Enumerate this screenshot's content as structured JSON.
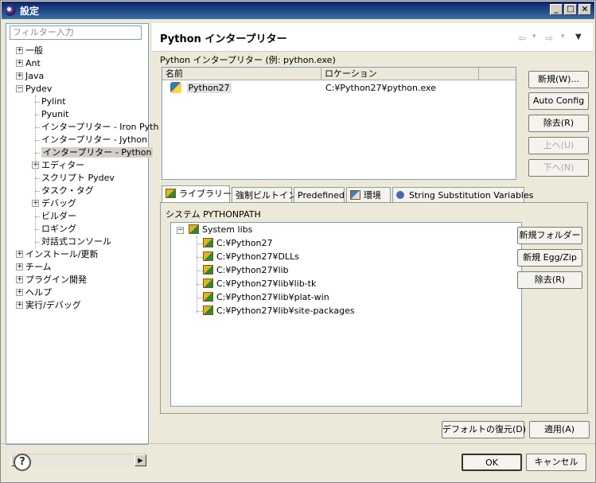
{
  "window": {
    "title": "設定",
    "min": "_",
    "max": "□",
    "close": "×"
  },
  "filter": {
    "placeholder": "フィルター入力"
  },
  "tree": {
    "items": [
      {
        "label": "一般",
        "level": 0,
        "expander": "+"
      },
      {
        "label": "Ant",
        "level": 0,
        "expander": "+"
      },
      {
        "label": "Java",
        "level": 0,
        "expander": "+"
      },
      {
        "label": "Pydev",
        "level": 0,
        "expander": "−"
      },
      {
        "label": "Pylint",
        "level": 1,
        "expander": ""
      },
      {
        "label": "Pyunit",
        "level": 1,
        "expander": ""
      },
      {
        "label": "インタープリター - Iron Pyth",
        "level": 1,
        "expander": ""
      },
      {
        "label": "インタープリター - Jython",
        "level": 1,
        "expander": ""
      },
      {
        "label": "インタープリター - Python",
        "level": 1,
        "expander": "",
        "selected": true
      },
      {
        "label": "エディター",
        "level": 1,
        "expander": "+"
      },
      {
        "label": "スクリプト Pydev",
        "level": 1,
        "expander": ""
      },
      {
        "label": "タスク・タグ",
        "level": 1,
        "expander": ""
      },
      {
        "label": "デバッグ",
        "level": 1,
        "expander": "+"
      },
      {
        "label": "ビルダー",
        "level": 1,
        "expander": ""
      },
      {
        "label": "ロギング",
        "level": 1,
        "expander": ""
      },
      {
        "label": "対話式コンソール",
        "level": 1,
        "expander": ""
      },
      {
        "label": "インストール/更新",
        "level": 0,
        "expander": "+"
      },
      {
        "label": "チーム",
        "level": 0,
        "expander": "+"
      },
      {
        "label": "プラグイン開発",
        "level": 0,
        "expander": "+"
      },
      {
        "label": "ヘルプ",
        "level": 0,
        "expander": "+"
      },
      {
        "label": "実行/デバッグ",
        "level": 0,
        "expander": "+"
      }
    ],
    "scroll_left": "◀",
    "scroll_right": "▶"
  },
  "page": {
    "title": "Python インタープリター",
    "nav_back": "⇦",
    "nav_forward": "⇨",
    "nav_dropdown": "▾",
    "nav_menu": "▼",
    "interpreter_label": "Python インタープリター (例: python.exe)"
  },
  "interpreters": {
    "columns": [
      "名前",
      "ロケーション"
    ],
    "rows": [
      {
        "name": "Python27",
        "location": "C:¥Python27¥python.exe"
      }
    ]
  },
  "interp_buttons": {
    "new": "新規(W)...",
    "auto": "Auto Config",
    "remove": "除去(R)",
    "up": "上へ(U)",
    "down": "下へ(N)"
  },
  "tabs": [
    "ライブラリー",
    "強制ビルトイン",
    "Predefined",
    "環境",
    "String Substitution Variables"
  ],
  "libraries": {
    "label": "システム PYTHONPATH",
    "root": "System libs",
    "root_expander": "−",
    "paths": [
      "C:¥Python27",
      "C:¥Python27¥DLLs",
      "C:¥Python27¥lib",
      "C:¥Python27¥lib¥lib-tk",
      "C:¥Python27¥lib¥plat-win",
      "C:¥Python27¥lib¥site-packages"
    ]
  },
  "lib_buttons": {
    "new_folder": "新規フォルダー",
    "new_egg": "新規 Egg/Zip",
    "remove": "除去(R)"
  },
  "page_buttons": {
    "restore": "デフォルトの復元(D)",
    "apply": "適用(A)"
  },
  "dialog_buttons": {
    "help": "?",
    "ok": "OK",
    "cancel": "キャンセル"
  }
}
